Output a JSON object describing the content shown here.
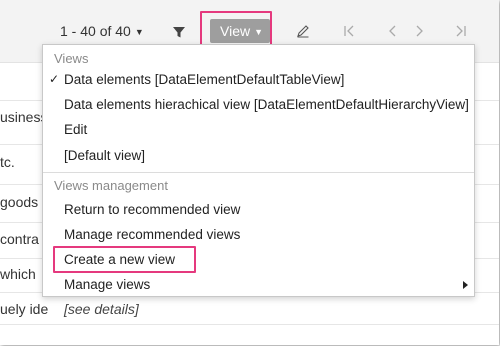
{
  "toolbar": {
    "pager_count": "1 - 40 of 40",
    "view_label": "View"
  },
  "icons": {
    "filter": "filter-icon",
    "edit": "pencil-icon",
    "first": "first-page-icon",
    "prev": "prev-page-icon",
    "next": "next-page-icon",
    "last": "last-page-icon"
  },
  "background_rows": [
    {
      "text": "usiness"
    },
    {
      "text": "tc."
    },
    {
      "text": "goods c"
    },
    {
      "text": "contra"
    },
    {
      "text": "which"
    },
    {
      "text": "uely ide"
    }
  ],
  "see_details": "[see details]",
  "menu": {
    "views_header": "Views",
    "views": [
      {
        "label": "Data elements [DataElementDefaultTableView]",
        "checked": true
      },
      {
        "label": "Data elements hierachical view [DataElementDefaultHierarchyView]",
        "checked": false
      },
      {
        "label": "Edit",
        "checked": false
      },
      {
        "label": "[Default view]",
        "checked": false
      }
    ],
    "management_header": "Views management",
    "management": [
      {
        "label": "Return to recommended view"
      },
      {
        "label": "Manage recommended views"
      },
      {
        "label": "Create a new view"
      },
      {
        "label": "Manage views"
      }
    ],
    "check_mark": "✓"
  },
  "colors": {
    "highlight": "#e5397e",
    "view_button": "#9e9e9e"
  }
}
